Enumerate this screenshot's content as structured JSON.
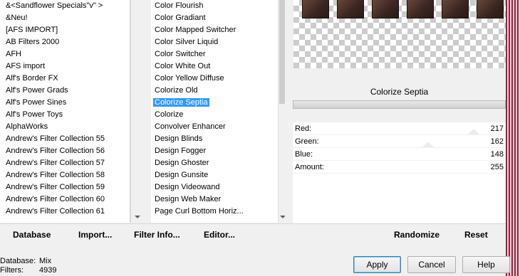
{
  "categories": [
    "&<Sandflower Specials\"v\" >",
    "&Neu!",
    "[AFS IMPORT]",
    "AB Filters 2000",
    "AFH",
    "AFS import",
    "Alf's Border FX",
    "Alf's Power Grads",
    "Alf's Power Sines",
    "Alf's Power Toys",
    "AlphaWorks",
    "Andrew's Filter Collection 55",
    "Andrew's Filter Collection 56",
    "Andrew's Filter Collection 57",
    "Andrew's Filter Collection 58",
    "Andrew's Filter Collection 59",
    "Andrew's Filter Collection 60",
    "Andrew's Filter Collection 61"
  ],
  "filters": [
    "Color Flourish",
    "Color Gradiant",
    "Color Mapped Switcher",
    "Color Silver Liquid",
    "Color Switcher",
    "Color White Out",
    "Color Yellow Diffuse",
    "Colorize Old",
    "Colorize Septia",
    "Colorize",
    "Convolver Enhancer",
    "Design Blinds",
    "Design Fogger",
    "Design Ghoster",
    "Design Gunsite",
    "Design Videowand",
    "Design Web Maker",
    "Page Curl Bottom Horiz..."
  ],
  "selected_filter_index": 8,
  "effect_title": "Colorize Septia",
  "params": [
    {
      "label": "Red:",
      "value": "217",
      "fraction": 0.851
    },
    {
      "label": "Green:",
      "value": "162",
      "fraction": 0.635
    },
    {
      "label": "Blue:",
      "value": "148",
      "fraction": 0.58
    },
    {
      "label": "Amount:",
      "value": "255",
      "fraction": 1.0
    }
  ],
  "bottom_links": {
    "database": "Database",
    "import": "Import...",
    "filter_info": "Filter Info...",
    "editor": "Editor...",
    "randomize": "Randomize",
    "reset": "Reset"
  },
  "status": {
    "database_label": "Database:",
    "database_value": "Mix",
    "filters_label": "Filters:",
    "filters_value": "4939"
  },
  "buttons": {
    "apply": "Apply",
    "cancel": "Cancel",
    "help": "Help"
  },
  "colors": {
    "selection": "#3399ff",
    "tile": "#3a2520",
    "border_stripe": "#9a2040"
  }
}
